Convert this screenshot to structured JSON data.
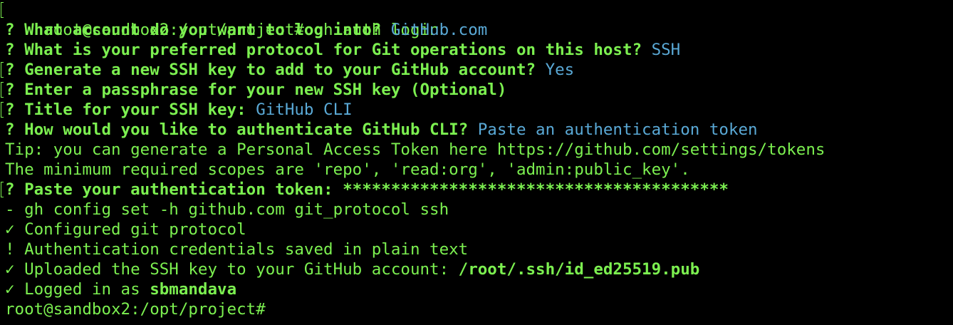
{
  "colors": {
    "background": "#000000",
    "text_green": "#7CF050",
    "answer_blue": "#5AA9D6"
  },
  "lines": [
    {
      "prompt": "root@sandbox2:/opt/project#",
      "command": " gh auth login"
    },
    {
      "q": "? What account do you want to log into?",
      "a": " GitHub.com"
    },
    {
      "q": "? What is your preferred protocol for Git operations on this host?",
      "a": " SSH"
    },
    {
      "q": "? Generate a new SSH key to add to your GitHub account?",
      "a": " Yes"
    },
    {
      "q": "? Enter a passphrase for your new SSH key (Optional)",
      "a": ""
    },
    {
      "q": "? Title for your SSH key:",
      "a": " GitHub CLI"
    },
    {
      "q": "? How would you like to authenticate GitHub CLI?",
      "a": " Paste an authentication token"
    },
    {
      "text": "Tip: you can generate a Personal Access Token here https://github.com/settings/tokens"
    },
    {
      "text": "The minimum required scopes are 'repo', 'read:org', 'admin:public_key'."
    },
    {
      "q": "? Paste your authentication token:",
      "a": " ****************************************"
    },
    {
      "text": "- gh config set -h github.com git_protocol ssh"
    },
    {
      "text": "✓ Configured git protocol"
    },
    {
      "text": "! Authentication credentials saved in plain text"
    },
    {
      "text": "✓ Uploaded the SSH key to your GitHub account: ",
      "bold": "/root/.ssh/id_ed25519.pub"
    },
    {
      "text": "✓ Logged in as ",
      "bold": "sbmandava"
    },
    {
      "prompt": "root@sandbox2:/opt/project#",
      "command": ""
    }
  ]
}
